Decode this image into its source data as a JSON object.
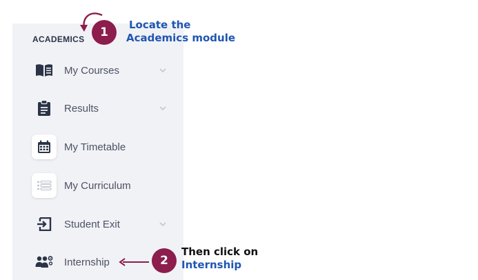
{
  "sidebar": {
    "section_title": "ACADEMICS",
    "items": [
      {
        "label": "My Courses",
        "icon": "book-icon",
        "has_chevron": true
      },
      {
        "label": "Results",
        "icon": "clipboard-icon",
        "has_chevron": true
      },
      {
        "label": "My Timetable",
        "icon": "calendar-icon",
        "has_chevron": false
      },
      {
        "label": "My Curriculum",
        "icon": "list-icon",
        "has_chevron": false
      },
      {
        "label": "Student Exit",
        "icon": "exit-icon",
        "has_chevron": true
      },
      {
        "label": "Internship",
        "icon": "users-gear-icon",
        "has_chevron": false
      }
    ]
  },
  "callouts": {
    "step1": {
      "number": "1",
      "line1": "Locate the",
      "line2": "Academics module"
    },
    "step2": {
      "number": "2",
      "line1": "Then click on",
      "line2": "Internship"
    }
  },
  "colors": {
    "accent": "#8c1d4d",
    "link_blue": "#1f56b3",
    "sidebar_bg": "#f1f2f6",
    "icon_dark": "#2b3346"
  }
}
